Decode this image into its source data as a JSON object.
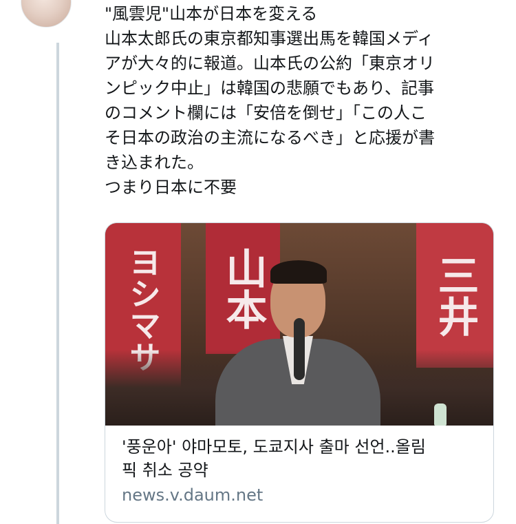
{
  "tweet": {
    "text_lines": [
      "\"風雲児\"山本が日本を変える",
      "山本太郎氏の東京都知事選出馬を韓国メディ",
      "アが大々的に報道。山本氏の公約「東京オリ",
      "ンピック中止」は韓国の悲願でもあり、記事",
      "のコメント欄には「安倍を倒せ」「この人こ",
      "そ日本の政治の主流になるべき」と応援が書",
      "き込まれた。",
      "つまり日本に不要"
    ]
  },
  "link_card": {
    "image_banners": [
      "ヨシマサ",
      "山本",
      "三井"
    ],
    "title_lines": [
      "'풍운아' 야마모토, 도쿄지사 출마 선언..올림",
      "픽 취소 공약"
    ],
    "domain": "news.v.daum.net"
  },
  "colors": {
    "text": "#14171a",
    "secondary_text": "#657786",
    "border": "#ccd6dd",
    "thread_line": "#ccd6dd",
    "banner_red": "#b8323a"
  }
}
